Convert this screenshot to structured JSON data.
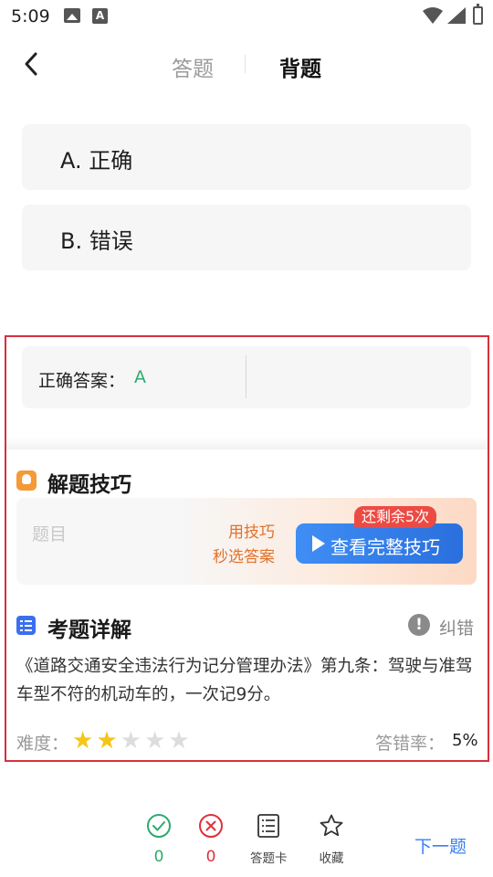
{
  "status_bar": {
    "time": "5:09",
    "icons": [
      "image-icon",
      "a-icon",
      "wifi-icon",
      "signal-icon",
      "battery-icon"
    ]
  },
  "header": {
    "back_icon": "chevron-left-icon",
    "tabs": [
      {
        "label": "答题",
        "active": false
      },
      {
        "label": "背题",
        "active": true
      }
    ]
  },
  "options": [
    {
      "label": "A. 正确"
    },
    {
      "label": "B. 错误"
    }
  ],
  "answer": {
    "label": "正确答案：",
    "value": "A"
  },
  "tips": {
    "title": "解题技巧",
    "placeholder_text": "题目",
    "promo_line1": "用技巧",
    "promo_line2": "秒选答案",
    "button_label": "查看完整技巧",
    "remaining_badge": "还剩余5次"
  },
  "explanation": {
    "title": "考题详解",
    "report_label": "纠错",
    "text": "《道路交通安全违法行为记分管理办法》第九条：驾驶与准驾车型不符的机动车的，一次记9分。",
    "difficulty_label": "难度：",
    "difficulty_stars": 2,
    "difficulty_max": 5,
    "error_rate_label": "答错率：",
    "error_rate": "5%"
  },
  "bottom_bar": {
    "correct_count": "0",
    "wrong_count": "0",
    "answer_card_label": "答题卡",
    "favorite_label": "收藏",
    "next_label": "下一题"
  },
  "colors": {
    "accent_blue": "#3a7ff0",
    "correct_green": "#2eaa6c",
    "wrong_red": "#e0303a",
    "highlight_red": "#d7303a",
    "star_yellow": "#f5c518",
    "tips_orange": "#e2722b"
  }
}
